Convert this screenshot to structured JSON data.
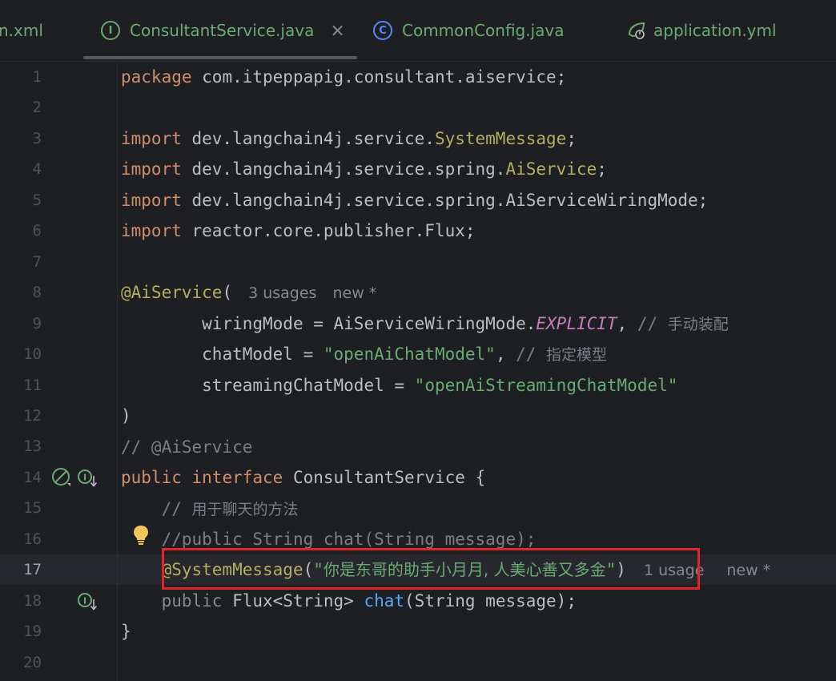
{
  "tabs": [
    {
      "label": "n.xml",
      "icon": "none",
      "active": false
    },
    {
      "label": "ConsultantService.java",
      "icon": "interface-icon",
      "active": true,
      "icon_glyph": "I"
    },
    {
      "label": "CommonConfig.java",
      "icon": "class-icon",
      "active": false,
      "icon_glyph": "C"
    },
    {
      "label": "application.yml",
      "icon": "spring-config-icon",
      "active": false
    }
  ],
  "tab_close_glyph": "×",
  "line_numbers": [
    "1",
    "2",
    "3",
    "4",
    "5",
    "6",
    "7",
    "8",
    "9",
    "10",
    "11",
    "12",
    "13",
    "14",
    "15",
    "16",
    "17",
    "18",
    "19",
    "20"
  ],
  "current_line": "17",
  "code": {
    "l1": {
      "kw": "package",
      "rest": " com.itpeppapig.consultant.aiservice;"
    },
    "l3": {
      "kw": "import",
      "pkg": " dev.langchain4j.service.",
      "cls": "SystemMessage",
      "end": ";"
    },
    "l4": {
      "kw": "import",
      "pkg": " dev.langchain4j.service.spring.",
      "cls": "AiService",
      "end": ";"
    },
    "l5": {
      "kw": "import",
      "rest": " dev.langchain4j.service.spring.AiServiceWiringMode;"
    },
    "l6": {
      "kw": "import",
      "rest": " reactor.core.publisher.Flux;"
    },
    "l8": {
      "ann": "@AiService",
      "paren": "(",
      "usages": "3 usages",
      "new": "new *"
    },
    "l9": {
      "indent": "        ",
      "name": "wiringMode = AiServiceWiringMode.",
      "const": "EXPLICIT",
      "comma": ", ",
      "cmt": "// ",
      "cmt_cjk": "手动装配"
    },
    "l10": {
      "indent": "        ",
      "name": "chatModel = ",
      "str": "\"openAiChatModel\"",
      "comma": ", ",
      "cmt": "// ",
      "cmt_cjk": "指定模型"
    },
    "l11": {
      "indent": "        ",
      "name": "streamingChatModel = ",
      "str": "\"openAiStreamingChatModel\""
    },
    "l12": {
      "text": ")"
    },
    "l13": {
      "cmt": "// @AiService"
    },
    "l14": {
      "kw1": "public",
      "kw2": "interface",
      "name": " ConsultantService {"
    },
    "l15": {
      "indent": "    ",
      "cmt": "// ",
      "cmt_cjk": "用于聊天的方法"
    },
    "l16": {
      "indent": "    ",
      "cmt": "//public String chat(String message);"
    },
    "l17": {
      "indent": "    ",
      "ann": "@SystemMessage",
      "open": "(",
      "str_q1": "\"",
      "str_cjk": "你是东哥的助手小月月, 人美心善又多金",
      "str_q2": "\"",
      "close": ")",
      "usages": "1 usage",
      "new": "new *"
    },
    "l18": {
      "indent": "    ",
      "kw": "public",
      "type": " Flux<String> ",
      "fn": "chat",
      "rest": "(String message);"
    },
    "l19": {
      "text": "}"
    }
  },
  "colors": {
    "background": "#1e1f22",
    "keyword": "#cf8e6d",
    "annotation": "#b3ae60",
    "string": "#6aab73",
    "comment": "#7a7e85",
    "constant": "#c77dbb",
    "function": "#56a8f5",
    "highlight_border": "#e0252b"
  },
  "gutter_icons": {
    "line14": [
      "no-implementation-icon",
      "interface-implemented-icon"
    ],
    "line16": [
      "lightbulb-icon"
    ],
    "line18": [
      "method-implemented-icon"
    ]
  }
}
